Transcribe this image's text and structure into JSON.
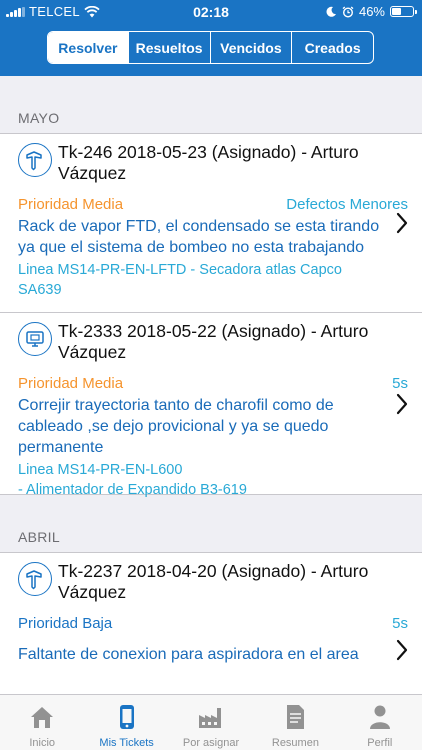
{
  "status_bar": {
    "carrier": "TELCEL",
    "time": "02:18",
    "battery": "46%",
    "battery_level": 0.46
  },
  "segments": [
    "Resolver",
    "Resueltos",
    "Vencidos",
    "Creados"
  ],
  "active_segment": "Resolver",
  "sections": [
    {
      "title": "MAYO",
      "tickets": [
        {
          "title": "Tk-246 2018-05-23 (Asignado) - Arturo Vázquez",
          "icon": "hammer-icon",
          "priority": "Prioridad Media",
          "category": "Defectos Menores",
          "description": "Rack de vapor FTD, el condensado se esta tirando ya que el sistema de bombeo no esta trabajando",
          "location": "Linea MS14-PR-EN-LFTD - Secadora atlas Capco SA639"
        },
        {
          "title": "Tk-2333 2018-05-22 (Asignado) - Arturo Vázquez",
          "icon": "monitor-icon",
          "priority": "Prioridad Media",
          "category": "5s",
          "description": "Correjir trayectoria tanto de charofil como de cableado ,se dejo provicional  y ya se quedo permanente",
          "location": "Linea MS14-PR-EN-L600\n - Alimentador de Expandido B3-619"
        }
      ]
    },
    {
      "title": "ABRIL",
      "tickets": [
        {
          "title": "Tk-2237 2018-04-20 (Asignado) - Arturo Vázquez",
          "icon": "hammer-icon",
          "priority": "Prioridad Baja",
          "category": "5s",
          "description": "Faltante de conexion para aspiradora en el area",
          "location": ""
        }
      ]
    }
  ],
  "tabs": [
    {
      "label": "Inicio",
      "icon": "home-icon"
    },
    {
      "label": "Mis Tickets",
      "icon": "phone-icon"
    },
    {
      "label": "Por asignar",
      "icon": "factory-icon"
    },
    {
      "label": "Resumen",
      "icon": "document-icon"
    },
    {
      "label": "Perfil",
      "icon": "person-icon"
    }
  ],
  "active_tab": "Mis Tickets",
  "colors": {
    "primary": "#1a74c4",
    "priority_media": "#f5942e",
    "accent_light": "#29a9d6",
    "tab_inactive": "#929292"
  }
}
